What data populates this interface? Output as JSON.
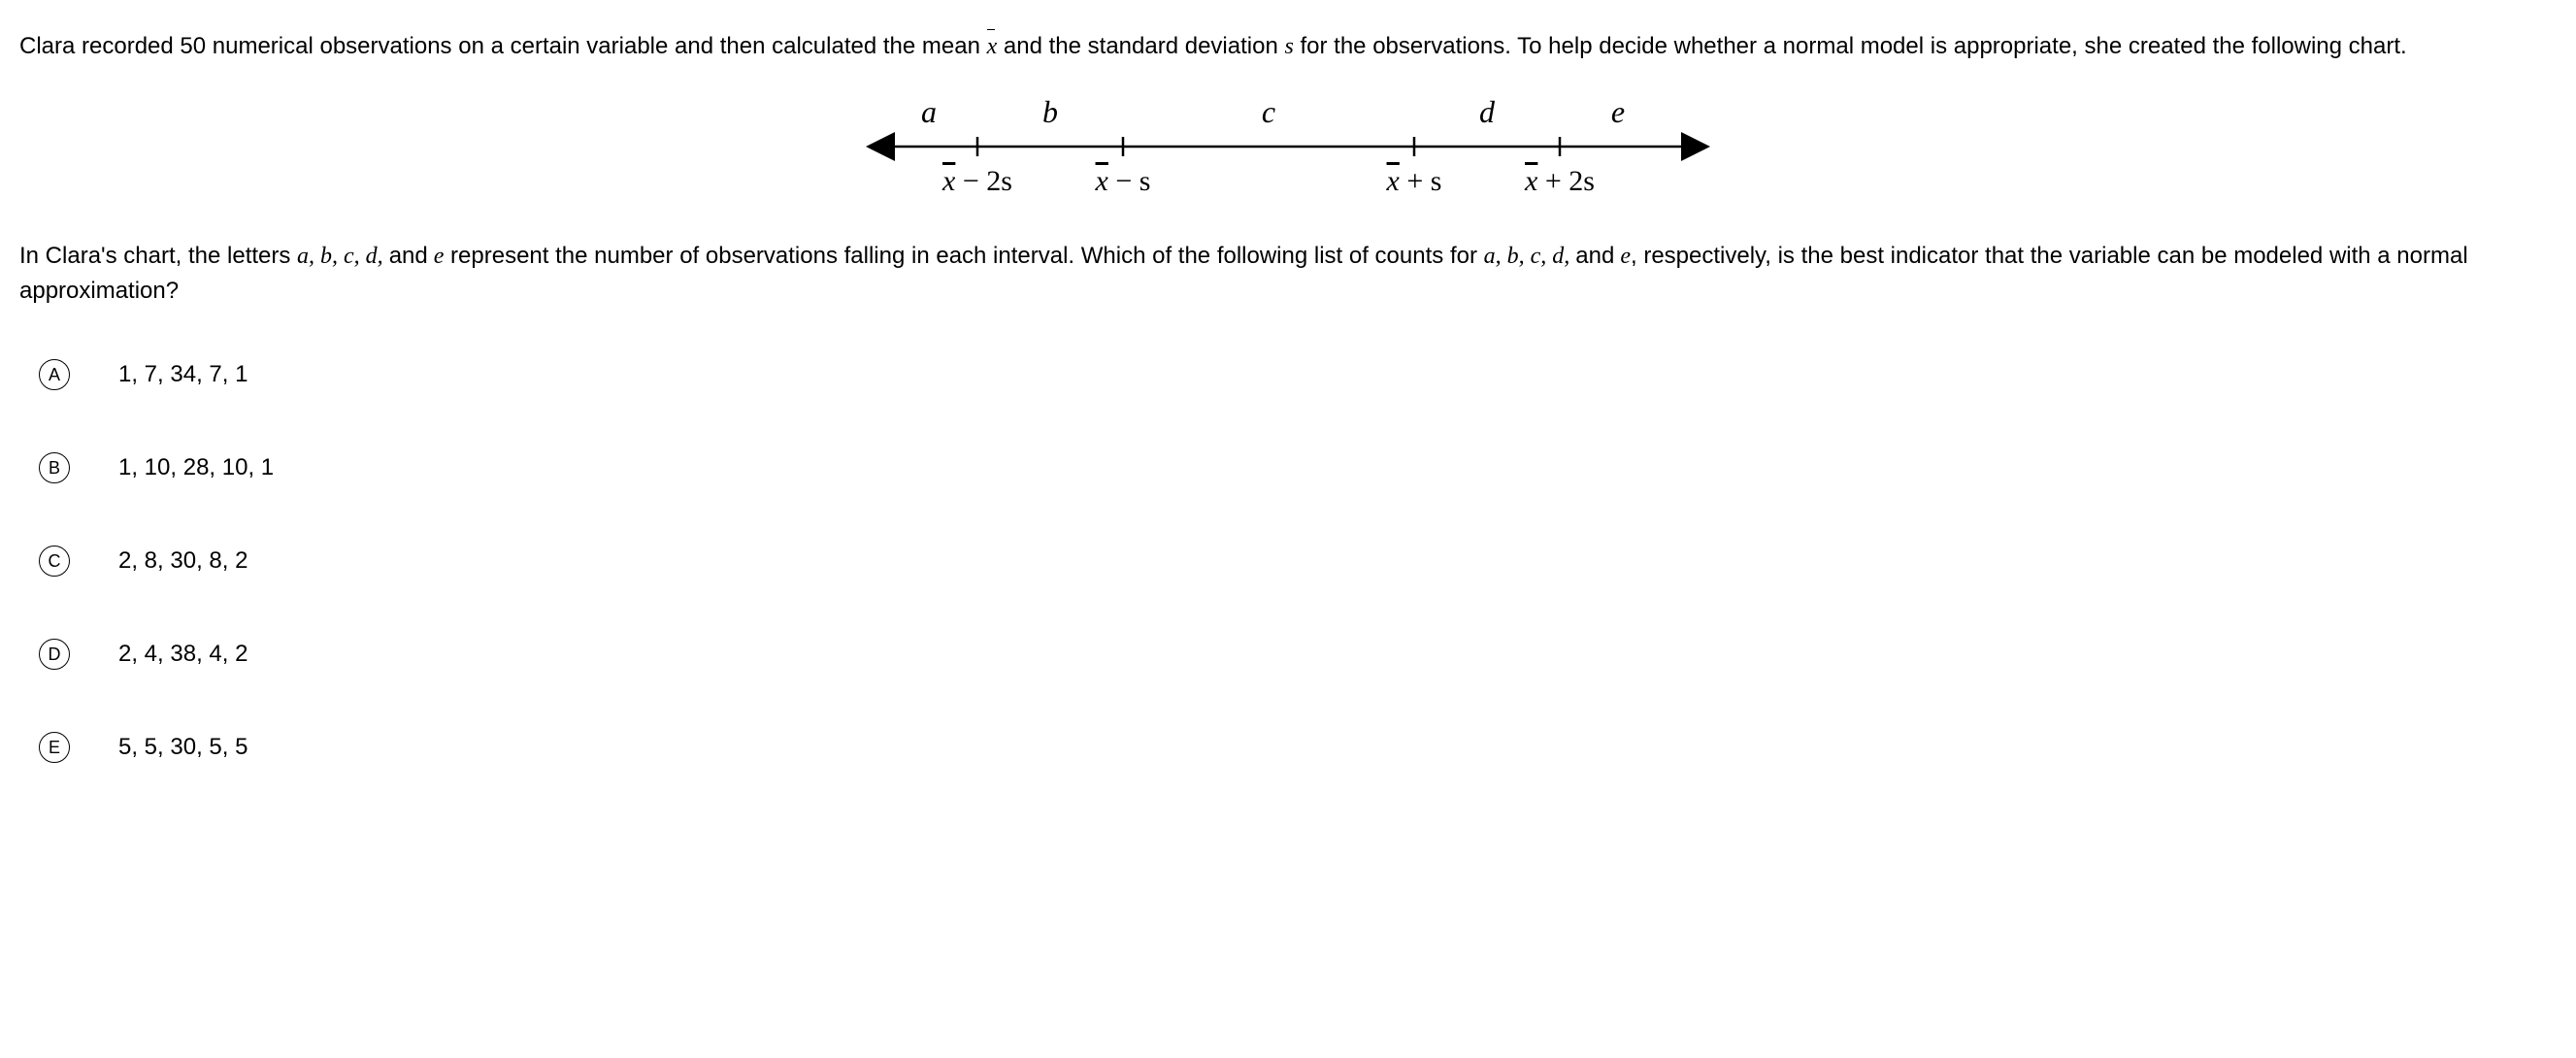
{
  "question": {
    "intro_before_xbar": "Clara recorded 50 numerical observations on a certain variable and then calculated the mean ",
    "intro_mid": " and the standard deviation ",
    "s_var": "s",
    "intro_after": " for the observations. To help decide whether a normal model is appropriate, she created the following chart.",
    "second_before": "In Clara's chart, the letters ",
    "letters_list": "a, b, c, d, ",
    "and_word": "and",
    "e_letter": " e",
    "second_mid": " represent the number of observations falling in each interval. Which of the following list of counts for ",
    "second_after": ", respectively, is the best indicator that the variable can be modeled with a normal approximation?"
  },
  "chart": {
    "interval_labels": [
      "a",
      "b",
      "c",
      "d",
      "e"
    ],
    "tick_labels": [
      "x̄ − 2s",
      "x̄ − s",
      "x̄ + s",
      "x̄ + 2s"
    ]
  },
  "options": [
    {
      "letter": "A",
      "text": "1, 7, 34, 7, 1"
    },
    {
      "letter": "B",
      "text": "1, 10, 28, 10, 1"
    },
    {
      "letter": "C",
      "text": "2, 8, 30, 8, 2"
    },
    {
      "letter": "D",
      "text": "2, 4, 38, 4, 2"
    },
    {
      "letter": "E",
      "text": "5, 5, 30, 5, 5"
    }
  ]
}
